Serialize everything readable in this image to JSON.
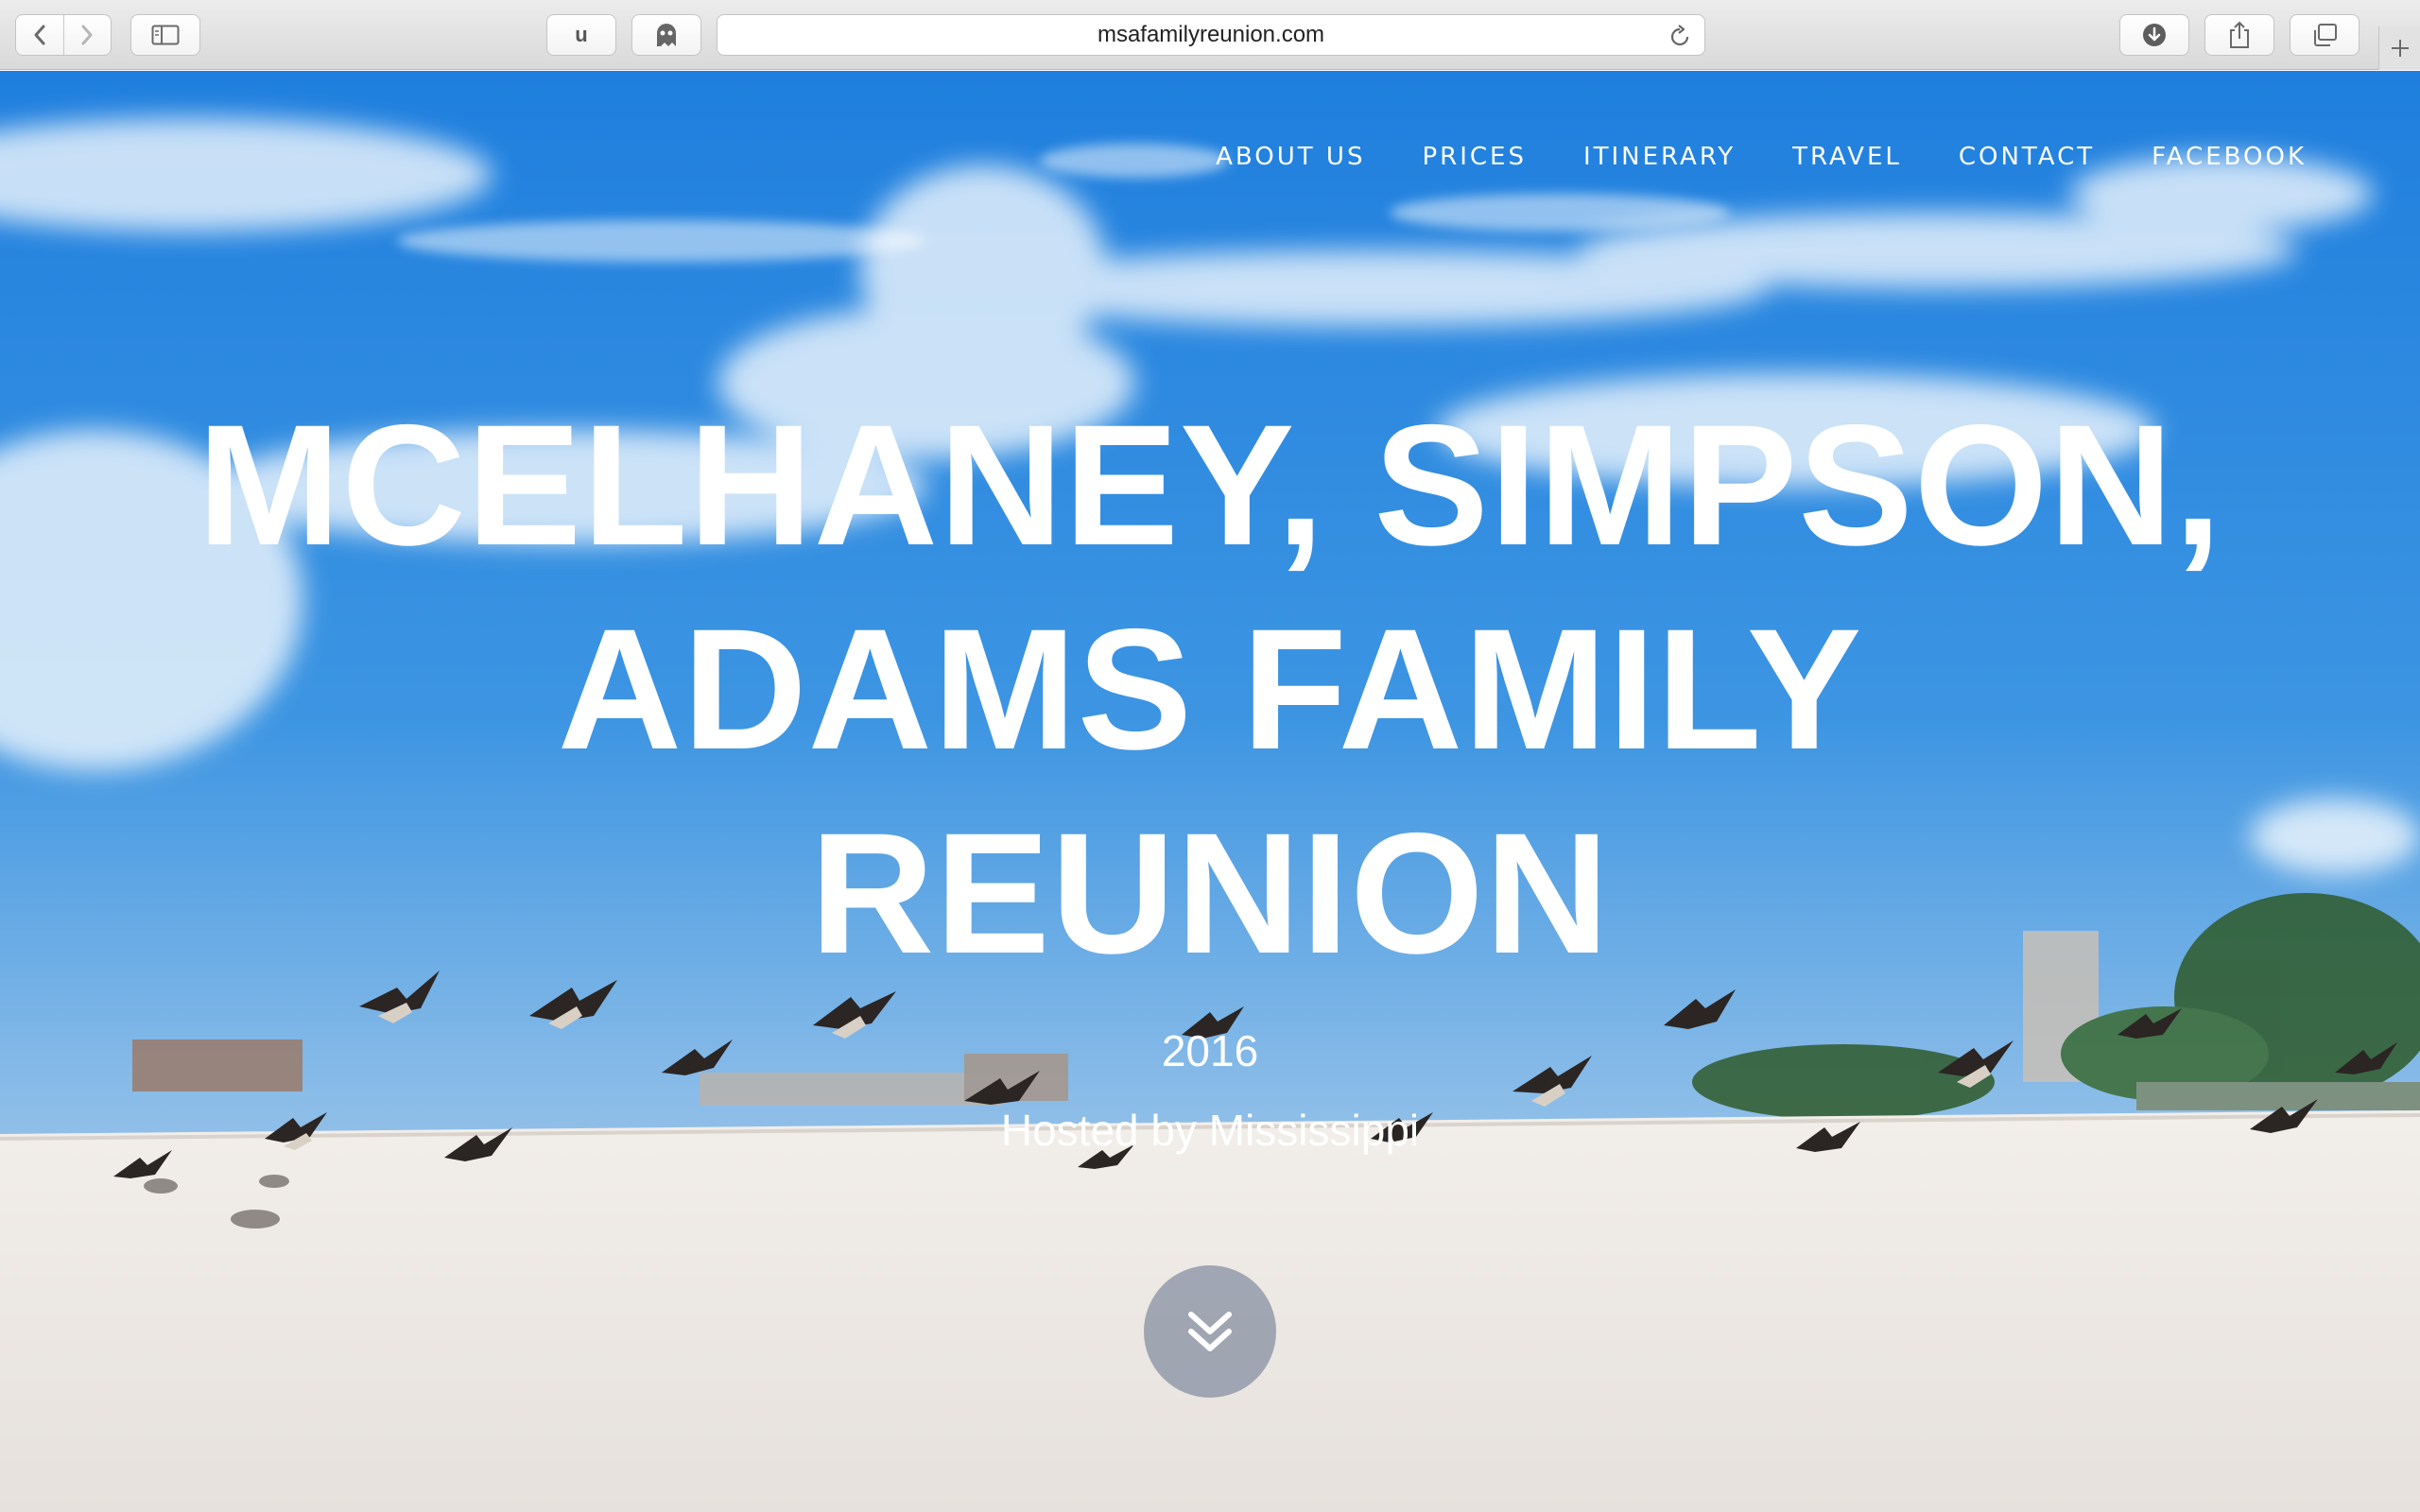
{
  "browser": {
    "url": "msafamilyreunion.com",
    "extension_label": "u",
    "icons": [
      "back-icon",
      "forward-icon",
      "sidebar-icon",
      "ghost-icon",
      "reload-icon",
      "download-icon",
      "share-icon",
      "tabs-icon",
      "new-tab-icon"
    ]
  },
  "nav": {
    "items": [
      {
        "label": "ABOUT US"
      },
      {
        "label": "PRICES"
      },
      {
        "label": "ITINERARY"
      },
      {
        "label": "TRAVEL"
      },
      {
        "label": "CONTACT"
      },
      {
        "label": "FACEBOOK"
      }
    ]
  },
  "hero": {
    "title_line1": "MCELHANEY, SIMPSON,",
    "title_line2": "ADAMS FAMILY",
    "title_line3": "REUNION",
    "year": "2016",
    "host": "Hosted by Mississippi",
    "scroll_icon": "double-chevron-down-icon"
  },
  "colors": {
    "sky": "#2f86d8",
    "sand": "#ece8e3",
    "text": "#ffffff",
    "scroll_button": "#828ca0"
  }
}
